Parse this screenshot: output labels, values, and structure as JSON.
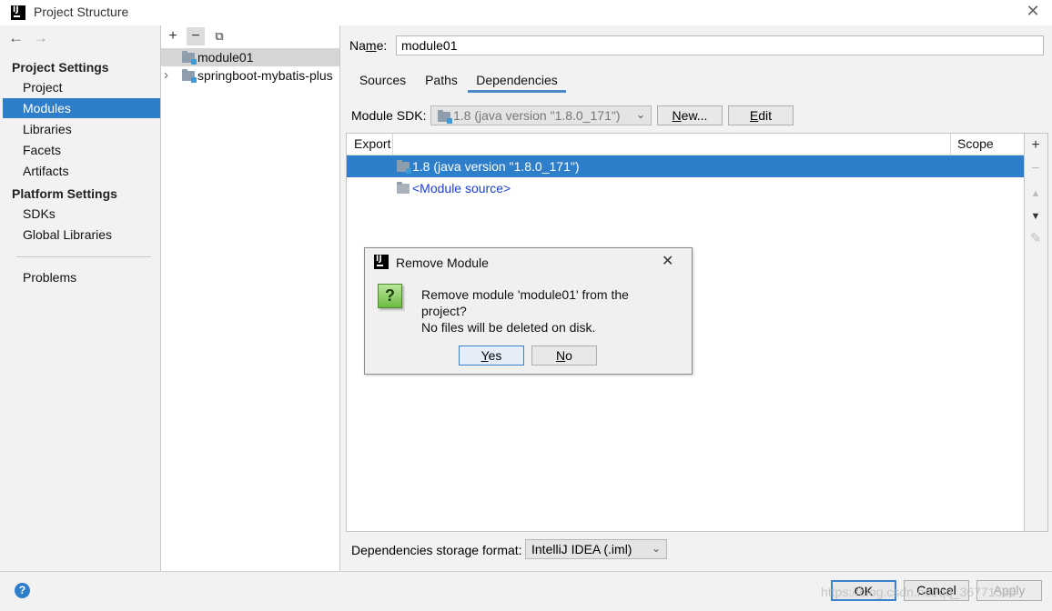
{
  "window": {
    "title": "Project Structure",
    "close_glyph": "✕"
  },
  "sidebar": {
    "back_glyph": "←",
    "forward_glyph": "→",
    "project_settings_header": "Project Settings",
    "project_items": [
      "Project",
      "Modules",
      "Libraries",
      "Facets",
      "Artifacts"
    ],
    "selected_item": "Modules",
    "platform_settings_header": "Platform Settings",
    "platform_items": [
      "SDKs",
      "Global Libraries"
    ],
    "problems": "Problems"
  },
  "module_tree": {
    "toolbar": {
      "add": "+",
      "remove": "−",
      "copy": "⧉"
    },
    "items": [
      {
        "label": "module01",
        "selected": true
      },
      {
        "label": "springboot-mybatis-plus",
        "expander": "›"
      }
    ]
  },
  "details": {
    "name_label": "Name:",
    "name_value": "module01",
    "tabs": [
      "Sources",
      "Paths",
      "Dependencies"
    ],
    "active_tab": "Dependencies",
    "sdk_label": "Module SDK:",
    "sdk_value": "1.8 (java version \"1.8.0_171\")",
    "new_button": "New...",
    "edit_button": "Edit",
    "table": {
      "col_export": "Export",
      "col_scope": "Scope",
      "rows": [
        {
          "label": "1.8 (java version \"1.8.0_171\")",
          "selected": true
        },
        {
          "label": "<Module source>",
          "link": true
        }
      ]
    },
    "side_tools": {
      "add": "+",
      "remove": "−",
      "up": "▲",
      "down": "▼",
      "edit": "✎"
    },
    "storage_label": "Dependencies storage format:",
    "storage_value": "IntelliJ IDEA (.iml)"
  },
  "footer": {
    "help": "?",
    "ok": "OK",
    "cancel": "Cancel",
    "apply": "Apply",
    "watermark": "https://blog.csdn.net/qq_36771565"
  },
  "dialog": {
    "title": "Remove Module",
    "close_glyph": "✕",
    "icon": "?",
    "line1": "Remove module 'module01' from the",
    "line2": "project?",
    "line3": "No files will be deleted on disk.",
    "yes": "Yes",
    "no": "No"
  },
  "colors": {
    "selection": "#2f7ec9",
    "tab_underline": "#4a88c7",
    "link": "#1a3ed8"
  }
}
